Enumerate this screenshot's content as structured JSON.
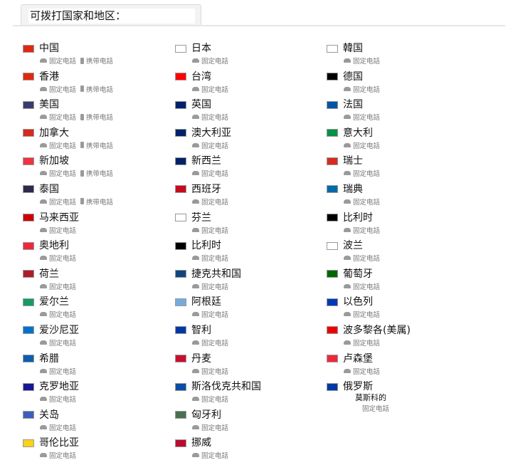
{
  "header": {
    "title": "可拨打国家和地区："
  },
  "services": {
    "landline": "固定电話",
    "mobile": "携带电話"
  },
  "countries": [
    {
      "name": "中国",
      "mobile": true
    },
    {
      "name": "香港",
      "mobile": true
    },
    {
      "name": "美国",
      "mobile": true
    },
    {
      "name": "加拿大",
      "mobile": true
    },
    {
      "name": "新加坡",
      "mobile": true
    },
    {
      "name": "泰国",
      "mobile": true
    },
    {
      "name": "马来西亚",
      "mobile": false
    },
    {
      "name": "奥地利",
      "mobile": false
    },
    {
      "name": "荷兰",
      "mobile": false
    },
    {
      "name": "爱尔兰",
      "mobile": false
    },
    {
      "name": "爱沙尼亚",
      "mobile": false
    },
    {
      "name": "希腊",
      "mobile": false
    },
    {
      "name": "克罗地亚",
      "mobile": false
    },
    {
      "name": "关岛",
      "mobile": false
    },
    {
      "name": "哥伦比亚",
      "mobile": false
    },
    {
      "name": "日本",
      "mobile": false
    },
    {
      "name": "台湾",
      "mobile": false
    },
    {
      "name": "英国",
      "mobile": false
    },
    {
      "name": "澳大利亚",
      "mobile": false
    },
    {
      "name": "新西兰",
      "mobile": false
    },
    {
      "name": "西班牙",
      "mobile": false
    },
    {
      "name": "芬兰",
      "mobile": false
    },
    {
      "name": "比利时",
      "mobile": false
    },
    {
      "name": "捷克共和国",
      "mobile": false
    },
    {
      "name": "阿根廷",
      "mobile": false
    },
    {
      "name": "智利",
      "mobile": false
    },
    {
      "name": "丹麦",
      "mobile": false
    },
    {
      "name": "斯洛伐克共和国",
      "mobile": false
    },
    {
      "name": "匈牙利",
      "mobile": false
    },
    {
      "name": "挪威",
      "mobile": false
    },
    {
      "name": "韓国",
      "mobile": false
    },
    {
      "name": "德国",
      "mobile": false
    },
    {
      "name": "法国",
      "mobile": false
    },
    {
      "name": "意大利",
      "mobile": false
    },
    {
      "name": "瑞士",
      "mobile": false
    },
    {
      "name": "瑞典",
      "mobile": false
    },
    {
      "name": "比利时",
      "mobile": false
    },
    {
      "name": "波兰",
      "mobile": false
    },
    {
      "name": "葡萄牙",
      "mobile": false
    },
    {
      "name": "以色列",
      "mobile": false
    },
    {
      "name": "波多黎各(美属)",
      "mobile": false
    },
    {
      "name": "卢森堡",
      "mobile": false
    },
    {
      "name": "俄罗斯",
      "mobile": false,
      "note": "莫斯科的"
    }
  ],
  "colors": {
    "flags": [
      "#de2910",
      "#de2910",
      "#3c3b6e",
      "#d52b1e",
      "#ef3340",
      "#2d2a4a",
      "#cc0001",
      "#ed2939",
      "#ae1c28",
      "#169b62",
      "#0072ce",
      "#0d5eaf",
      "#171796",
      "#3e5eb9",
      "#fcd116",
      "#ffffff",
      "#fe0000",
      "#012169",
      "#012169",
      "#012169",
      "#c60b1e",
      "#ffffff",
      "#000000",
      "#11457e",
      "#74acdf",
      "#0039a6",
      "#c8102e",
      "#0b4ea2",
      "#477050",
      "#ba0c2f",
      "#ffffff",
      "#000000",
      "#0055a4",
      "#009246",
      "#d52b1e",
      "#006aa7",
      "#000000",
      "#ffffff",
      "#006600",
      "#0038b8",
      "#ed0000",
      "#ed2939",
      "#0039a6"
    ]
  }
}
